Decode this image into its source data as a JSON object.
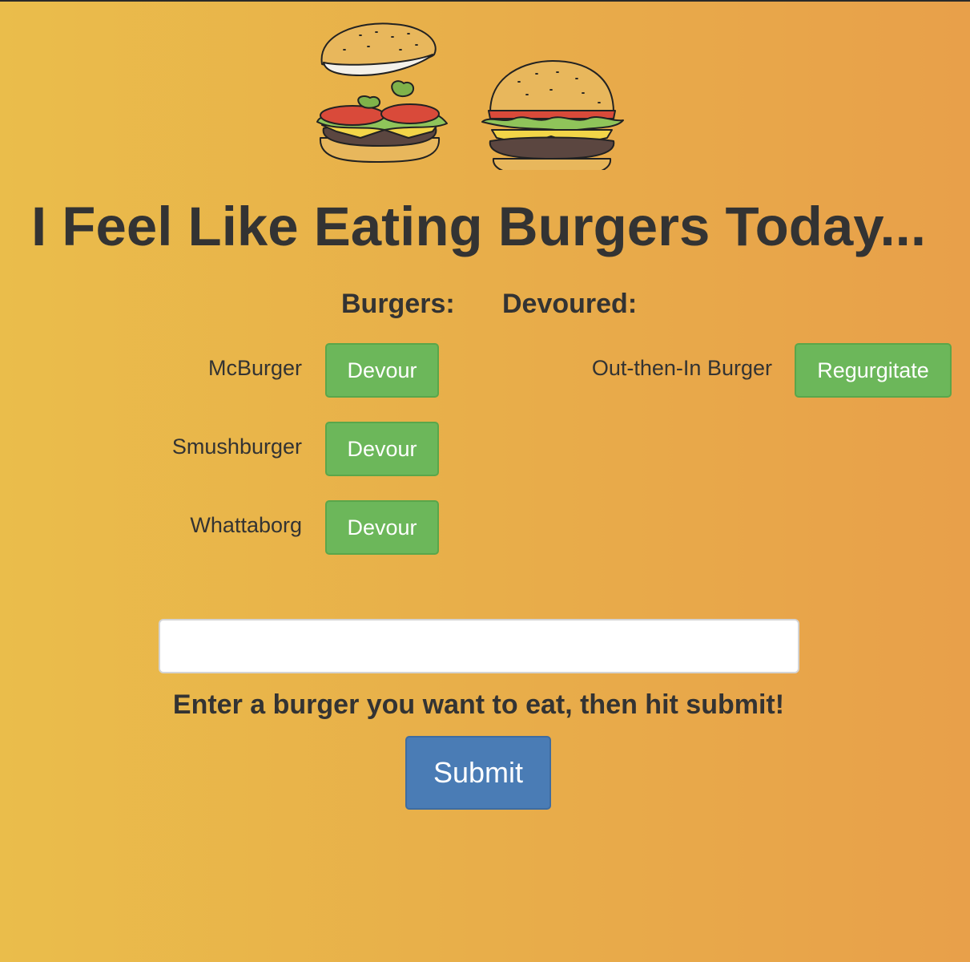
{
  "header": {
    "title": "I Feel Like Eating Burgers Today...",
    "illustration_icons": [
      "burger-deconstructed-icon",
      "burger-assembled-icon"
    ]
  },
  "columns": {
    "burgers_heading": "Burgers:",
    "devoured_heading": "Devoured:"
  },
  "burgers": [
    {
      "name": "McBurger",
      "button_label": "Devour"
    },
    {
      "name": "Smushburger",
      "button_label": "Devour"
    },
    {
      "name": "Whattaborg",
      "button_label": "Devour"
    }
  ],
  "devoured": [
    {
      "name": "Out-then-In Burger",
      "button_label": "Regurgitate"
    }
  ],
  "form": {
    "input_value": "",
    "input_placeholder": "",
    "instructions": "Enter a burger you want to eat, then hit submit!",
    "submit_label": "Submit"
  },
  "colors": {
    "background_gradient_start": "#eabd4b",
    "background_gradient_end": "#e8a04a",
    "success_button": "#6cb75a",
    "primary_button": "#4a7cb5",
    "text": "#333333"
  }
}
